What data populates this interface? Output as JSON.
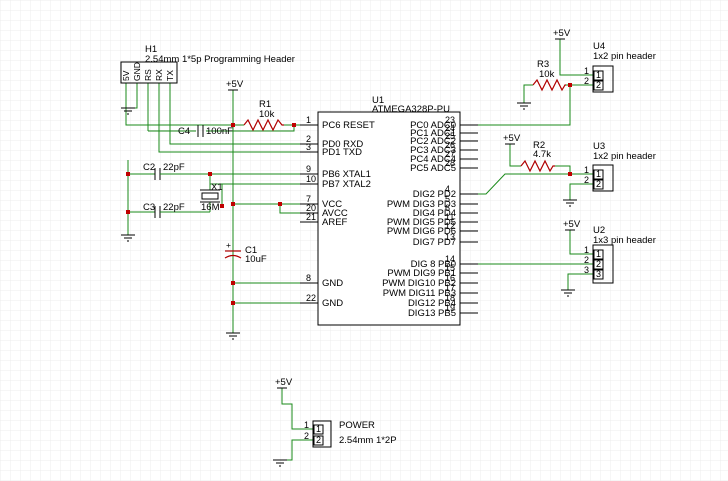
{
  "colors": {
    "wire": "#1a8a1a",
    "symbol": "#b00000",
    "junction": "#c00000",
    "grid": "#ececec"
  },
  "icons": [
    "ground-icon",
    "vcc-arrow-icon",
    "resistor-icon",
    "capacitor-icon",
    "crystal-icon"
  ],
  "power_label": "+5V",
  "u1": {
    "ref": "U1",
    "value": "ATMEGA328P-PU"
  },
  "u1_left_pins": [
    {
      "num": "1",
      "name": "PC6 RESET"
    },
    {
      "num": "2",
      "name": "PD0 RXD"
    },
    {
      "num": "3",
      "name": "PD1 TXD"
    },
    {
      "num": "9",
      "name": "PB6 XTAL1"
    },
    {
      "num": "10",
      "name": "PB7 XTAL2"
    },
    {
      "num": "7",
      "name": "VCC"
    },
    {
      "num": "20",
      "name": "AVCC"
    },
    {
      "num": "21",
      "name": "AREF"
    },
    {
      "num": "8",
      "name": "GND"
    },
    {
      "num": "22",
      "name": "GND"
    }
  ],
  "u1_right_pins": [
    {
      "num": "23",
      "name": "PC0 ADC0"
    },
    {
      "num": "24",
      "name": "PC1 ADC1"
    },
    {
      "num": "25",
      "name": "PC2 ADC2"
    },
    {
      "num": "26",
      "name": "PC3 ADC3"
    },
    {
      "num": "27",
      "name": "PC4 ADC4"
    },
    {
      "num": "28",
      "name": "PC5 ADC5"
    },
    {
      "num": "4",
      "name": "DIG2 PD2"
    },
    {
      "num": "5",
      "name": "PWM DIG3 PD3"
    },
    {
      "num": "6",
      "name": "DIG4 PD4"
    },
    {
      "num": "11",
      "name": "PWM DIG5 PD5"
    },
    {
      "num": "12",
      "name": "PWM DIG6 PD6"
    },
    {
      "num": "13",
      "name": "DIG7 PD7"
    },
    {
      "num": "14",
      "name": "DIG 8 PB0"
    },
    {
      "num": "15",
      "name": "PWM DIG9 PB1"
    },
    {
      "num": "16",
      "name": "PWM DIG10 PB2"
    },
    {
      "num": "17",
      "name": "PWM DIG11 PB3"
    },
    {
      "num": "18",
      "name": "DIG12 PB4"
    },
    {
      "num": "19",
      "name": "DIG13 PB5"
    }
  ],
  "h1": {
    "ref": "H1",
    "value": "2.54mm 1*5p Programming Header",
    "pins": [
      "5V",
      "GND",
      "RS",
      "RX",
      "TX"
    ]
  },
  "r1": {
    "ref": "R1",
    "value": "10k"
  },
  "r2": {
    "ref": "R2",
    "value": "4.7k"
  },
  "r3": {
    "ref": "R3",
    "value": "10k"
  },
  "c1": {
    "ref": "C1",
    "value": "10uF"
  },
  "c2": {
    "ref": "C2",
    "value": "22pF"
  },
  "c3": {
    "ref": "C3",
    "value": "22pF"
  },
  "c4": {
    "ref": "C4",
    "value": "100nF"
  },
  "x1": {
    "ref": "X1",
    "value": "16M"
  },
  "u2": {
    "ref": "U2",
    "value": "1x3 pin header",
    "pins": [
      "1",
      "2",
      "3"
    ]
  },
  "u3": {
    "ref": "U3",
    "value": "1x2 pin header",
    "pins": [
      "1",
      "2"
    ]
  },
  "u4": {
    "ref": "U4",
    "value": "1x2 pin header",
    "pins": [
      "1",
      "2"
    ]
  },
  "power": {
    "ref": "POWER",
    "value": "2.54mm 1*2P",
    "pins": [
      "1",
      "2"
    ]
  }
}
